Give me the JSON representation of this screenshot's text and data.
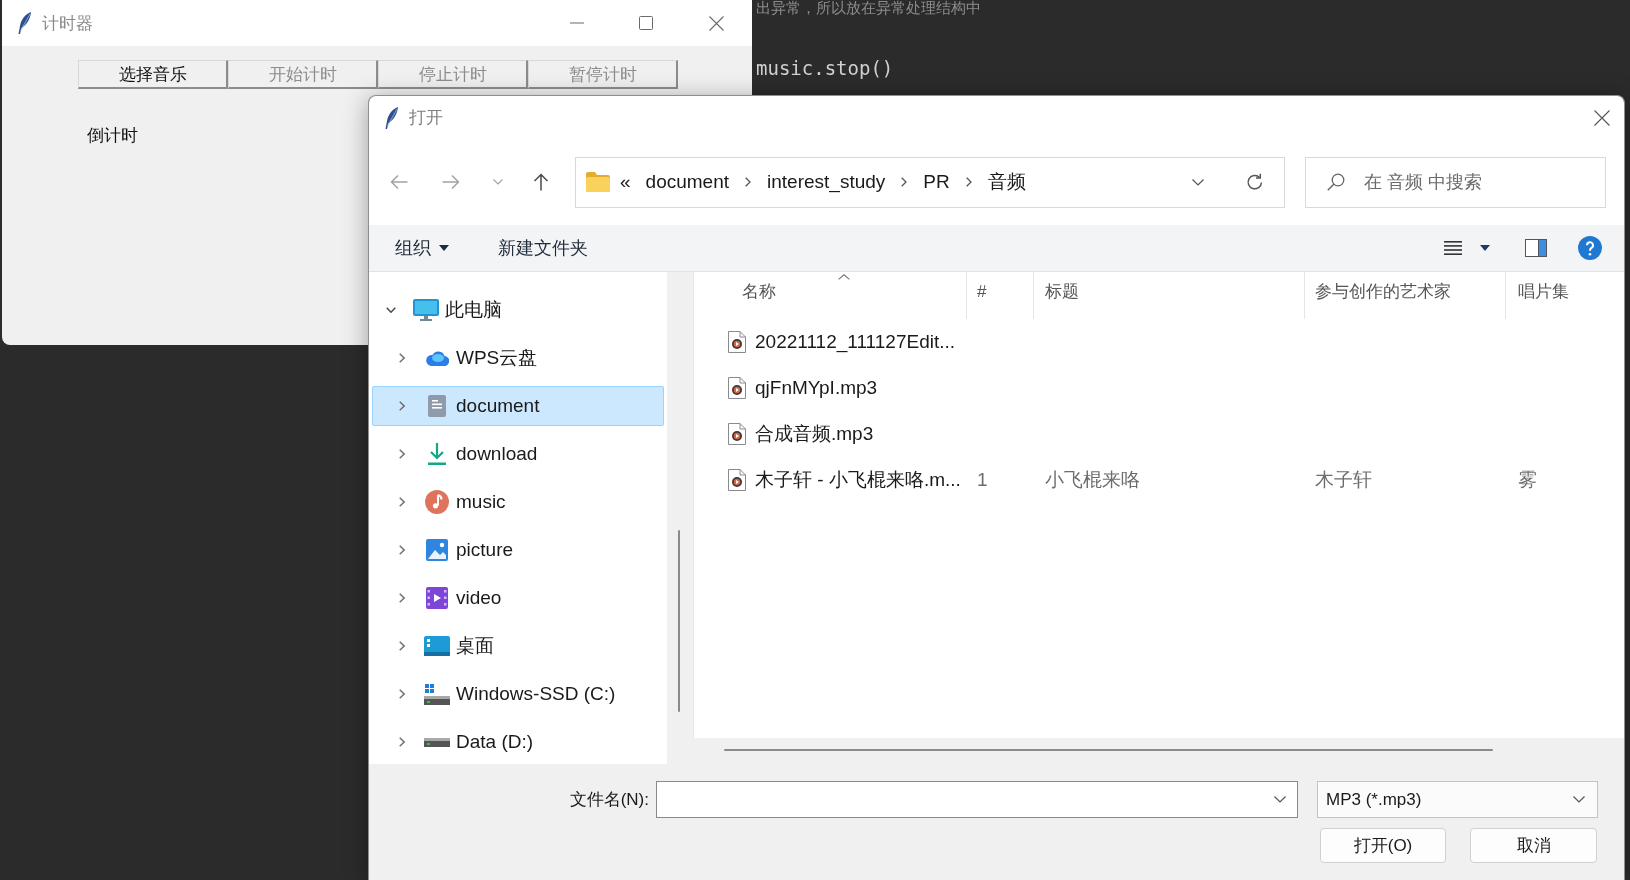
{
  "editor": {
    "lines": [
      {
        "kind": "comment",
        "text": "出异常，所以放在异常处理结构中"
      },
      {
        "kind": "code",
        "text": "music.stop()"
      }
    ]
  },
  "timer_window": {
    "title": "计时器",
    "buttons": [
      {
        "label": "选择音乐",
        "disabled": false
      },
      {
        "label": "开始计时",
        "disabled": true
      },
      {
        "label": "停止计时",
        "disabled": true
      },
      {
        "label": "暂停计时",
        "disabled": true
      }
    ],
    "countdown_label": "倒计时"
  },
  "open_dialog": {
    "title": "打开",
    "nav_buttons": [
      {
        "kind": "back",
        "disabled": true
      },
      {
        "kind": "forward",
        "disabled": true
      },
      {
        "kind": "recent",
        "disabled": true
      },
      {
        "kind": "up",
        "disabled": false
      }
    ],
    "address": {
      "overflow": "«",
      "crumbs": [
        "document",
        "interest_study",
        "PR",
        "音频"
      ]
    },
    "search": {
      "placeholder": "在 音频 中搜索"
    },
    "toolbar": {
      "organize": "组织",
      "new_folder": "新建文件夹"
    },
    "sidebar": {
      "items": [
        {
          "label": "此电脑",
          "expanded": true,
          "selected": false,
          "children": [
            {
              "label": "WPS云盘",
              "expanded": false,
              "selected": false
            },
            {
              "label": "document",
              "expanded": false,
              "selected": true
            },
            {
              "label": "download",
              "expanded": false,
              "selected": false
            },
            {
              "label": "music",
              "expanded": false,
              "selected": false
            },
            {
              "label": "picture",
              "expanded": false,
              "selected": false
            },
            {
              "label": "video",
              "expanded": false,
              "selected": false
            },
            {
              "label": "桌面",
              "expanded": false,
              "selected": false
            },
            {
              "label": "Windows-SSD (C:)",
              "expanded": false,
              "selected": false
            },
            {
              "label": "Data (D:)",
              "expanded": false,
              "selected": false
            }
          ]
        }
      ]
    },
    "file_list": {
      "columns": [
        {
          "label": "名称",
          "sorted": true
        },
        {
          "label": "#",
          "sorted": false
        },
        {
          "label": "标题",
          "sorted": false
        },
        {
          "label": "参与创作的艺术家",
          "sorted": false
        },
        {
          "label": "唱片集",
          "sorted": false
        }
      ],
      "rows": [
        {
          "name": "20221112_111127Edit..."
        },
        {
          "name": "qjFnMYpI.mp3"
        },
        {
          "name": "合成音频.mp3"
        },
        {
          "name": "木子轩 - 小飞棍来咯.m...",
          "number": "1",
          "title": "小飞棍来咯",
          "artist": "木子轩",
          "album": "雾"
        }
      ]
    },
    "footer": {
      "filename_label": "文件名(N):",
      "file_type": "MP3 (*.mp3)",
      "buttons": [
        "打开(O)",
        "取消"
      ]
    }
  }
}
